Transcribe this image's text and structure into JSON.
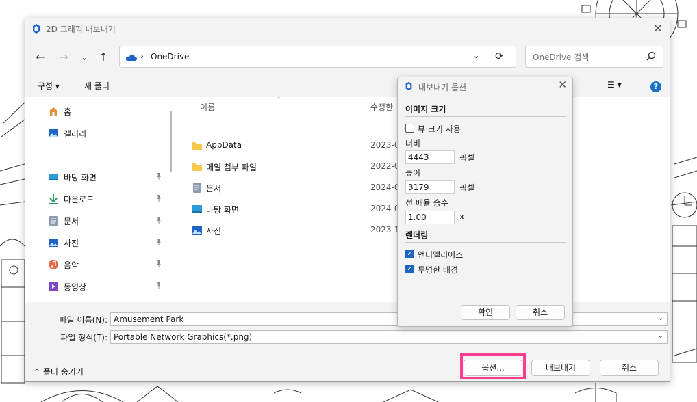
{
  "dialog": {
    "title": "2D 그래픽 내보내기",
    "close_glyph": "✕"
  },
  "nav": {
    "back": "←",
    "forward": "→",
    "recent": "⌄",
    "up": "↑",
    "address_sep": "›",
    "address": "OneDrive",
    "address_dropdown": "⌄",
    "refresh": "⟳",
    "search_placeholder": "OneDrive 검색"
  },
  "commands": {
    "organize": "구성 ▾",
    "new_folder": "새 폴더",
    "view": "☰ ▾",
    "help": "?"
  },
  "sidebar": {
    "items": [
      {
        "label": "홈",
        "icon": "home-icon",
        "pinned": false
      },
      {
        "label": "갤러리",
        "icon": "gallery-icon",
        "pinned": false
      },
      {
        "label": "바탕 화면",
        "icon": "desktop-icon",
        "pinned": true
      },
      {
        "label": "다운로드",
        "icon": "download-icon",
        "pinned": true
      },
      {
        "label": "문서",
        "icon": "document-icon",
        "pinned": true
      },
      {
        "label": "사진",
        "icon": "pictures-icon",
        "pinned": true
      },
      {
        "label": "음악",
        "icon": "music-icon",
        "pinned": true
      },
      {
        "label": "동영상",
        "icon": "video-icon",
        "pinned": true
      }
    ]
  },
  "files": {
    "columns": {
      "name": "이름",
      "modified": "수정한"
    },
    "rows": [
      {
        "name": "AppData",
        "date": "2023-0",
        "icon": "folder-icon"
      },
      {
        "name": "메일 첨부 파일",
        "date": "2022-0",
        "icon": "folder-icon"
      },
      {
        "name": "문서",
        "date": "2024-0",
        "icon": "document-icon"
      },
      {
        "name": "바탕 화면",
        "date": "2024-0",
        "icon": "desktop-icon"
      },
      {
        "name": "사진",
        "date": "2023-1",
        "icon": "pictures-icon"
      }
    ]
  },
  "bottom": {
    "filename_label": "파일 이름(N):",
    "filename_value": "Amusement Park",
    "filetype_label": "파일 형식(T):",
    "filetype_value": "Portable Network Graphics(*.png)",
    "dropdown_glyph": "⌄",
    "hide_folders": "⌃  폴더 숨기기",
    "options_button": "옵션...",
    "export_button": "내보내기",
    "cancel_button": "취소"
  },
  "options": {
    "title": "내보내기 옵션",
    "close_glyph": "✕",
    "image_size_header": "이미지 크기",
    "use_view_size": {
      "label": "뷰 크기 사용",
      "checked": false
    },
    "width_label": "너비",
    "width_value": "4443",
    "height_label": "높이",
    "height_value": "3179",
    "unit": "픽셀",
    "line_scale_label": "선 배율 승수",
    "line_scale_value": "1.00",
    "line_scale_unit": "x",
    "rendering_header": "렌더링",
    "antialias": {
      "label": "앤티앨리어스",
      "checked": true
    },
    "transparent": {
      "label": "투명한 배경",
      "checked": true
    },
    "ok_button": "확인",
    "cancel_button": "취소"
  },
  "colors": {
    "accent": "#1f64c4",
    "highlight": "#ff3d8f",
    "folder": "#f5c84c"
  }
}
